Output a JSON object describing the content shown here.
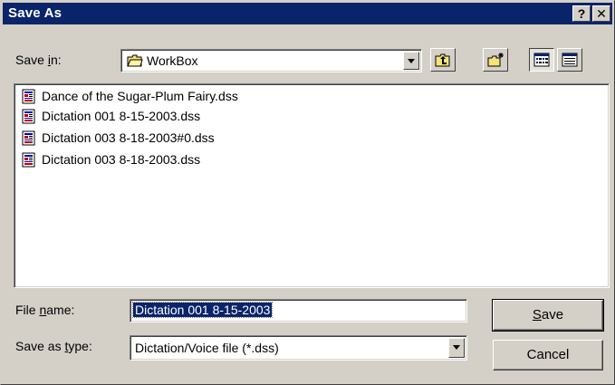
{
  "window": {
    "title": "Save As",
    "help_label": "?",
    "close_label": "✕"
  },
  "save_in": {
    "label_pre": "Save ",
    "label_access": "i",
    "label_post": "n:",
    "value": "WorkBox",
    "icon": "folder-icon"
  },
  "toolbar": {
    "up_icon": "up-one-level-icon",
    "new_folder_icon": "new-folder-icon",
    "list_view_icon": "list-view-icon",
    "details_view_icon": "details-view-icon",
    "pressed": "list-view"
  },
  "files": [
    {
      "name": "Dance of the Sugar-Plum Fairy.dss",
      "icon": "dss-file-icon"
    },
    {
      "name": "Dictation 001 8-15-2003.dss",
      "icon": "dss-file-icon"
    },
    {
      "name": "Dictation 003 8-18-2003#0.dss",
      "icon": "dss-file-icon"
    },
    {
      "name": "Dictation 003 8-18-2003.dss",
      "icon": "dss-file-icon"
    }
  ],
  "file_name": {
    "label_pre": "File ",
    "label_access": "n",
    "label_post": "ame:",
    "value": "Dictation 001 8-15-2003"
  },
  "save_type": {
    "label_pre": "Save as ",
    "label_access": "t",
    "label_post": "ype:",
    "value": "Dictation/Voice file (*.dss)"
  },
  "buttons": {
    "save_access": "S",
    "save_rest": "ave",
    "cancel": "Cancel"
  },
  "colors": {
    "titlebar": "#0a246a",
    "face": "#d4d0c8",
    "selection": "#0a246a"
  }
}
